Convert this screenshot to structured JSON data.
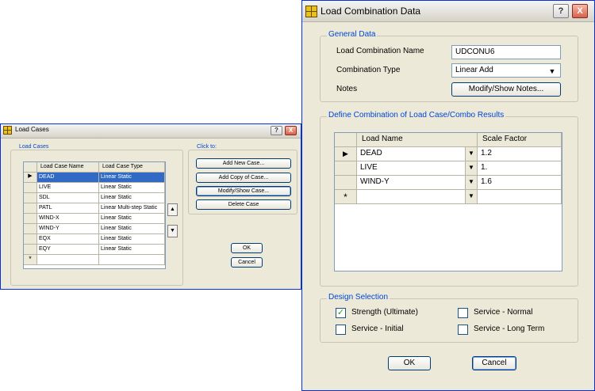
{
  "load_cases_dialog": {
    "title": "Load Cases",
    "help_label": "?",
    "close_label": "X",
    "group_load_cases": "Load Cases",
    "table": {
      "columns": [
        "Load Case Name",
        "Load Case Type"
      ],
      "rows": [
        {
          "name": "DEAD",
          "type": "Linear Static"
        },
        {
          "name": "LIVE",
          "type": "Linear Static"
        },
        {
          "name": "SDL",
          "type": "Linear Static"
        },
        {
          "name": "PATL",
          "type": "Linear Multi-step Static"
        },
        {
          "name": "WIND-X",
          "type": "Linear Static"
        },
        {
          "name": "WIND-Y",
          "type": "Linear Static"
        },
        {
          "name": "EQX",
          "type": "Linear Static"
        },
        {
          "name": "EQY",
          "type": "Linear Static"
        }
      ],
      "new_row_marker": "*"
    },
    "group_click_to": "Click to:",
    "buttons": {
      "add_new": "Add New Case...",
      "add_copy": "Add Copy of Case...",
      "modify_show": "Modify/Show Case...",
      "delete": "Delete Case",
      "ok": "OK",
      "cancel": "Cancel"
    }
  },
  "combo_dialog": {
    "title": "Load Combination Data",
    "help_label": "?",
    "close_label": "X",
    "general": {
      "legend": "General Data",
      "name_label": "Load Combination Name",
      "name_value": "UDCONU6",
      "type_label": "Combination Type",
      "type_value": "Linear Add",
      "notes_label": "Notes",
      "notes_button": "Modify/Show Notes..."
    },
    "define": {
      "legend": "Define Combination of Load Case/Combo Results",
      "col_case": "Load Name",
      "col_factor": "Scale Factor",
      "rows": [
        {
          "case": "DEAD",
          "factor": "1.2"
        },
        {
          "case": "LIVE",
          "factor": "1."
        },
        {
          "case": "WIND-Y",
          "factor": "1.6"
        }
      ],
      "new_row_marker": "*"
    },
    "design": {
      "legend": "Design Selection",
      "options": [
        {
          "label": "Strength (Ultimate)",
          "checked": true
        },
        {
          "label": "Service - Normal",
          "checked": false
        },
        {
          "label": "Service - Initial",
          "checked": false
        },
        {
          "label": "Service - Long Term",
          "checked": false
        }
      ]
    },
    "buttons": {
      "ok": "OK",
      "cancel": "Cancel"
    }
  }
}
